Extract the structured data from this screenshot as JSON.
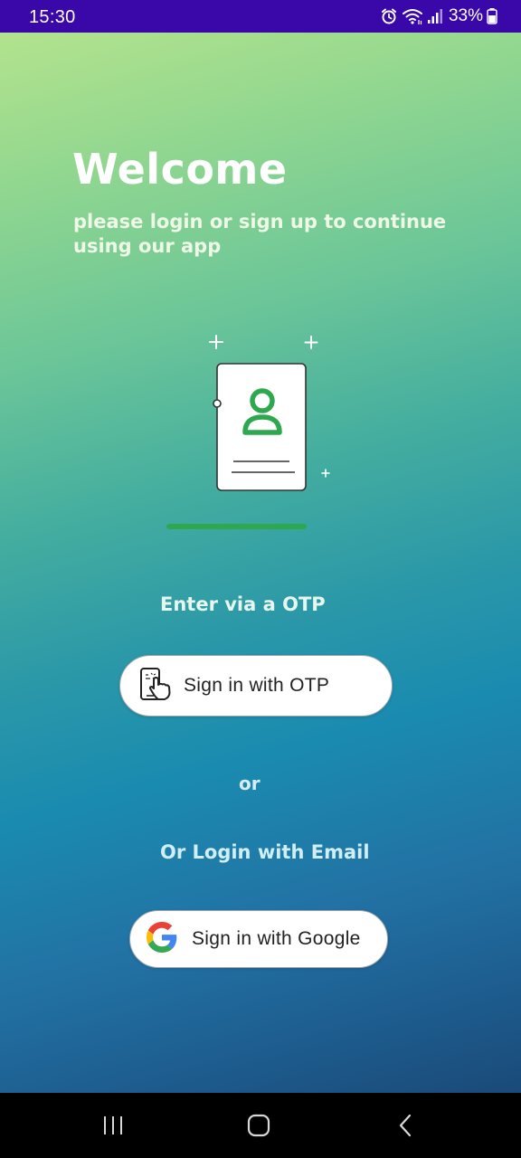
{
  "status_bar": {
    "time": "15:30",
    "battery_percent": "33%",
    "icons": [
      "alarm-icon",
      "wifi-icon",
      "signal-icon",
      "battery-icon"
    ]
  },
  "welcome": {
    "title": "Welcome",
    "subtitle": "please login or sign up to continue using our app"
  },
  "otp": {
    "label": "Enter via a OTP",
    "button_label": "Sign in with OTP",
    "icon": "phone-touch-icon"
  },
  "separator": {
    "label": "or"
  },
  "email": {
    "label": "Or Login with Email",
    "button_label": "Sign in with Google",
    "icon": "google-logo-icon"
  },
  "illustration": {
    "icon": "user-id-card-icon",
    "accent_color": "#2ea84f"
  },
  "navigation_bar": {
    "icons": [
      "recents-icon",
      "home-icon",
      "back-icon"
    ]
  },
  "colors": {
    "status_bar": "#3a07a8",
    "gradient_top": "#b3e38d",
    "gradient_mid": "#1a8bb0",
    "gradient_bottom": "#1a4a78",
    "button_background": "#ffffff",
    "accent_green": "#2ea84f"
  }
}
